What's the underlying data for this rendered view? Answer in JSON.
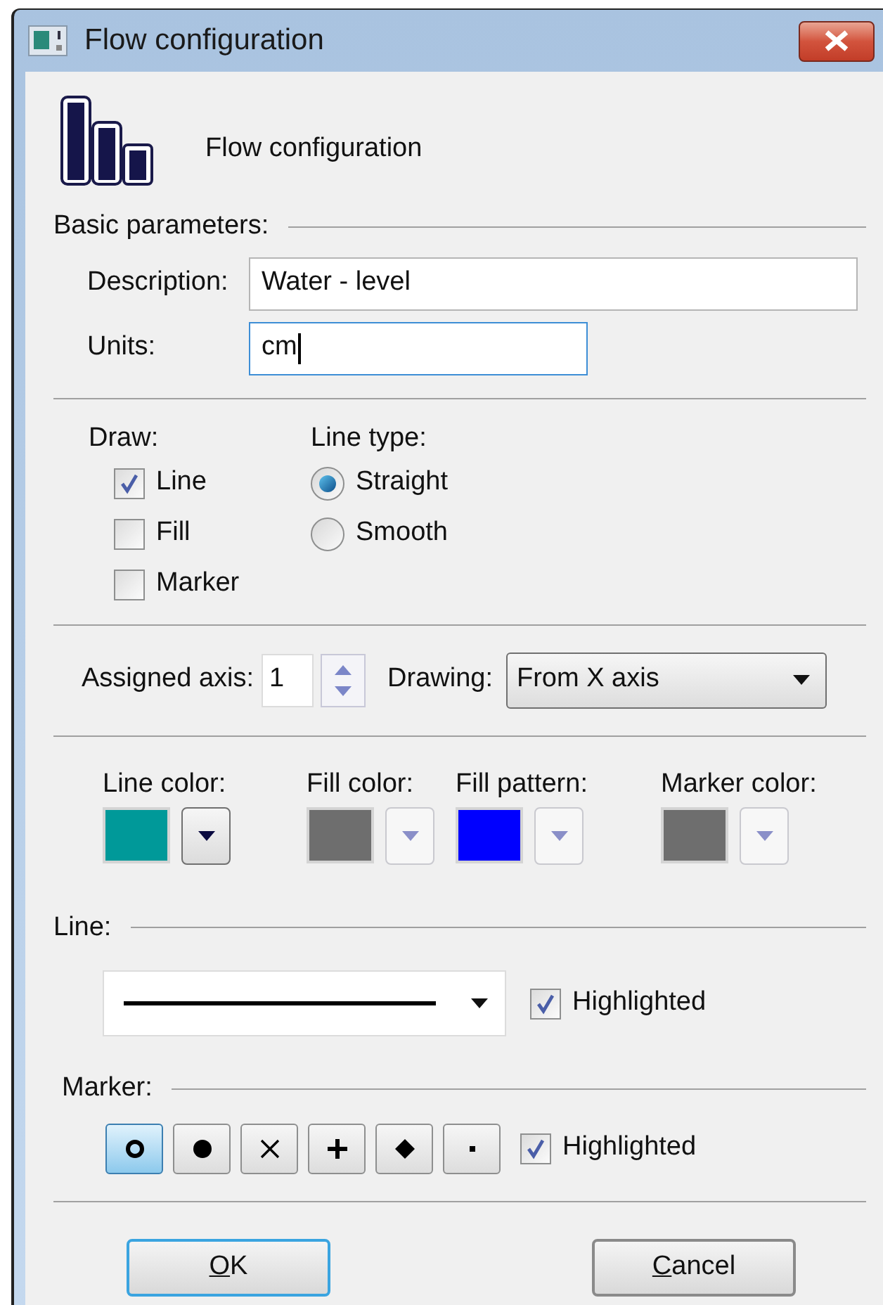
{
  "window": {
    "title": "Flow configuration"
  },
  "header": {
    "title": "Flow configuration"
  },
  "basic_parameters": {
    "label": "Basic parameters:",
    "fields": [
      {
        "label": "Description:",
        "value": "Water - level",
        "focused": false
      },
      {
        "label": "Units:",
        "value": "cm",
        "focused": true
      }
    ]
  },
  "draw": {
    "label": "Draw:",
    "options": [
      {
        "label": "Line",
        "checked": true
      },
      {
        "label": "Fill",
        "checked": false
      },
      {
        "label": "Marker",
        "checked": false
      }
    ]
  },
  "line_type": {
    "label": "Line type:",
    "options": [
      {
        "label": "Straight",
        "selected": true
      },
      {
        "label": "Smooth",
        "selected": false
      }
    ]
  },
  "assigned_axis": {
    "label": "Assigned axis:",
    "value": "1"
  },
  "drawing": {
    "label": "Drawing:",
    "value": "From X axis"
  },
  "colors": [
    {
      "label": "Line color:",
      "color": "#009999",
      "disabled": false
    },
    {
      "label": "Fill color:",
      "color": "#6e6e6e",
      "disabled": true
    },
    {
      "label": "Fill pattern:",
      "color": "#0000ff",
      "disabled": true
    },
    {
      "label": "Marker color:",
      "color": "#6e6e6e",
      "disabled": true
    }
  ],
  "line": {
    "label": "Line:",
    "highlighted": {
      "label": "Highlighted",
      "checked": true
    }
  },
  "marker": {
    "label": "Marker:",
    "shapes": [
      {
        "kind": "circle",
        "selected": true
      },
      {
        "kind": "disc",
        "selected": false
      },
      {
        "kind": "cross",
        "selected": false
      },
      {
        "kind": "plus",
        "selected": false
      },
      {
        "kind": "diamond",
        "selected": false
      },
      {
        "kind": "point",
        "selected": false
      }
    ],
    "highlighted": {
      "label": "Highlighted",
      "checked": true
    }
  },
  "buttons": [
    {
      "label": "OK",
      "default": true
    },
    {
      "label": "Cancel",
      "default": false
    }
  ]
}
